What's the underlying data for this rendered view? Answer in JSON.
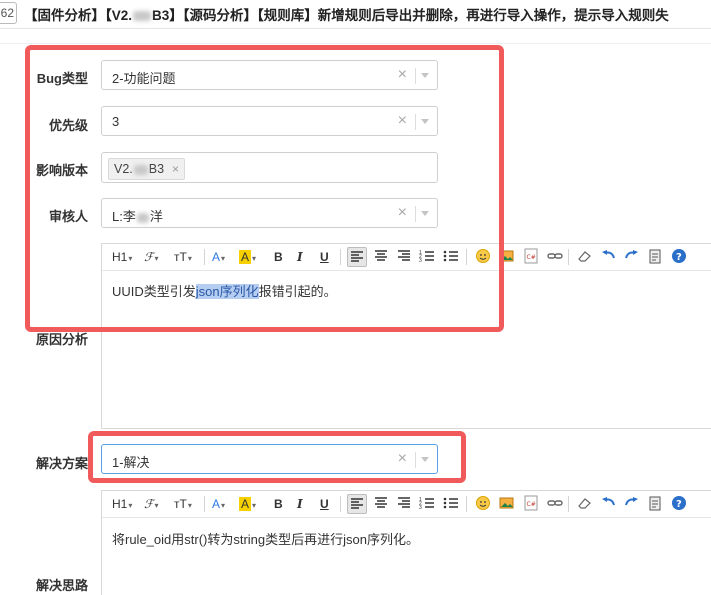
{
  "header": {
    "issue_id": "62",
    "title_parts": [
      "【固件分析】【V2.",
      "B3】【源码分析】【规则库】新增规则后导出并删除，再进行导入操作，提示导入规则失"
    ]
  },
  "fields": {
    "bug_type": {
      "label": "Bug类型",
      "value": "2-功能问题"
    },
    "priority": {
      "label": "优先级",
      "value": "3"
    },
    "affected_version": {
      "label": "影响版本",
      "tag_prefix": "V2.",
      "tag_suffix": "B3",
      "remove": "×"
    },
    "reviewer": {
      "label": "审核人",
      "value_prefix": "L:李",
      "value_suffix": "洋"
    },
    "cause_analysis": {
      "label": "原因分析",
      "text_before": "UUID类型引发",
      "text_highlight": "json序列化",
      "text_after": "报错引起的。"
    },
    "solution": {
      "label": "解决方案",
      "value": "1-解决"
    },
    "solution_idea": {
      "label": "解决思路",
      "text": "将rule_oid用str()转为string类型后再进行json序列化。"
    }
  },
  "select_clear_icon": "×",
  "toolbar": {
    "heading": "H1",
    "font_family": "ℱ",
    "font_size": "тT",
    "font_color": "A",
    "bg_color": "A",
    "bold": "B",
    "italic": "I",
    "underline": "U",
    "dropdown_caret": "▾"
  },
  "colors": {
    "red_highlight": "#f05a5a",
    "selection": "#b4cdf0",
    "font_color_icon": "#2a7ae2",
    "bg_color_icon": "#f7d000"
  }
}
